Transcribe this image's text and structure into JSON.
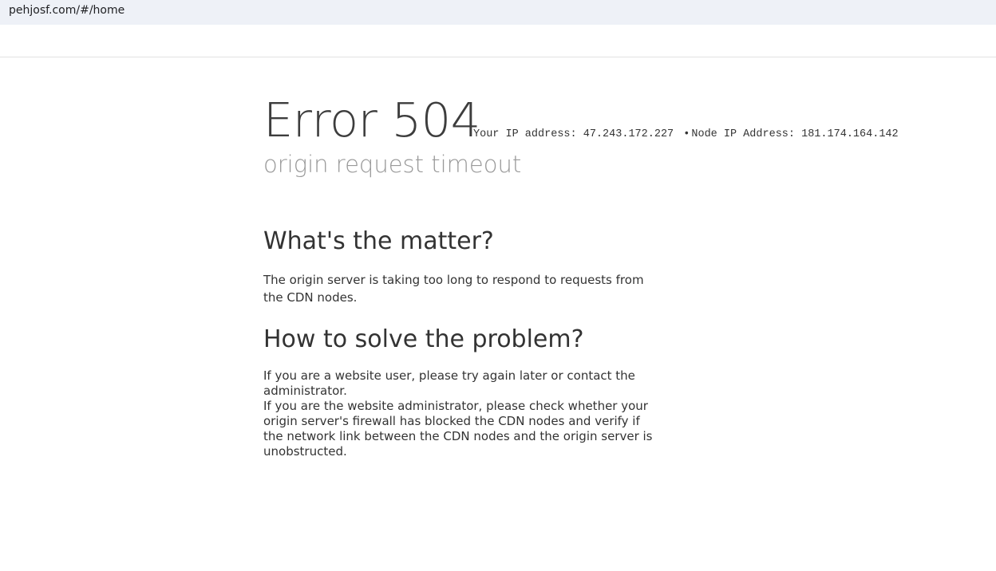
{
  "browser": {
    "url": "pehjosf.com/#/home"
  },
  "error": {
    "title": "Error 504",
    "subtitle": "origin request timeout",
    "ip_info": {
      "your_ip_label": "Your IP address:",
      "your_ip": "47.243.172.227",
      "separator": "•",
      "node_ip_label": "Node IP Address:",
      "node_ip": "181.174.164.142"
    }
  },
  "sections": {
    "matter": {
      "heading": "What's the matter?",
      "text": "The origin server is taking too long to respond to requests from the CDN nodes."
    },
    "solve": {
      "heading": "How to solve the problem?",
      "user_text": "If you are a website user, please try again later or contact the administrator.",
      "admin_text": "If you are the website administrator, please check whether your origin server's firewall has blocked the CDN nodes and verify if the network link between the CDN nodes and the origin server is unobstructed."
    }
  }
}
